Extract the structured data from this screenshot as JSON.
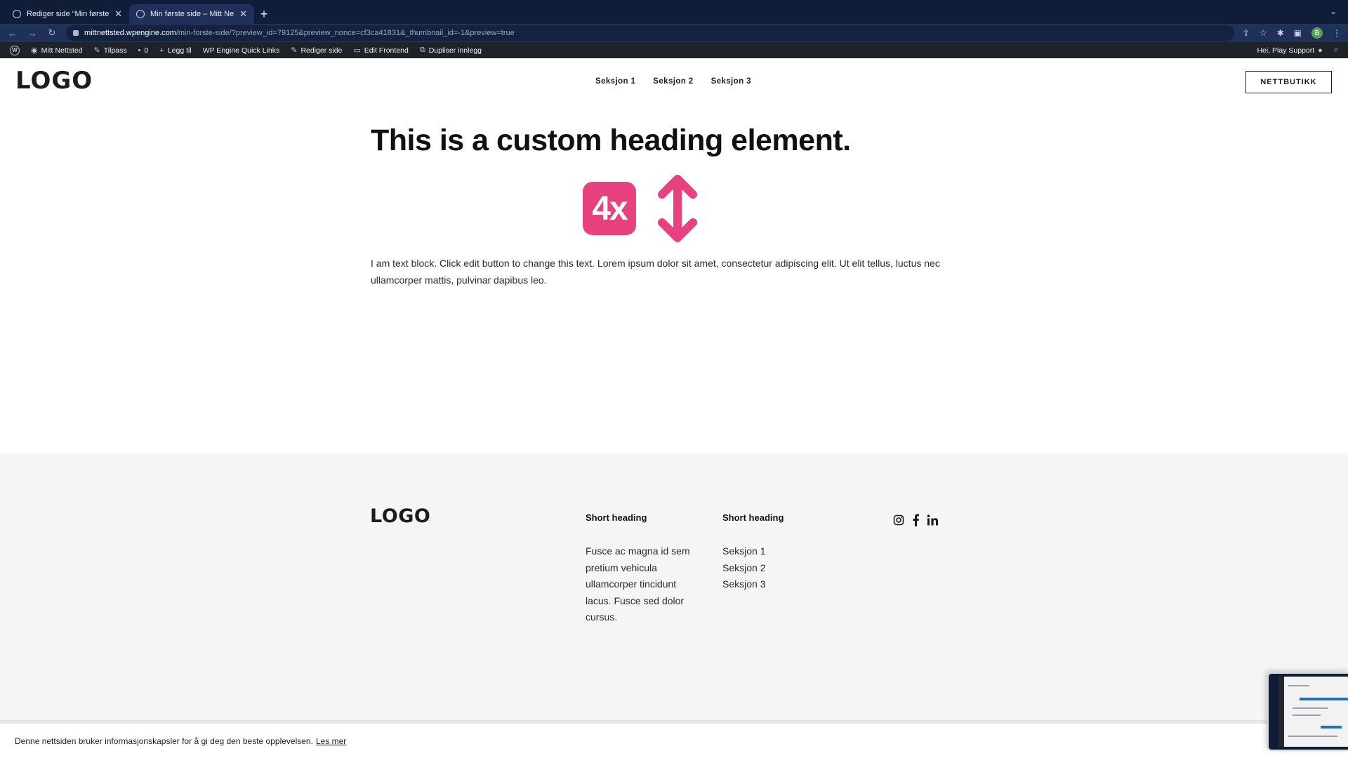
{
  "browser": {
    "tabs": [
      {
        "label": "Rediger side “Min første side”",
        "active": false
      },
      {
        "label": "Min første side – Mitt Nettsted",
        "active": true
      }
    ],
    "url_host": "mittnettsted.wpengine.com",
    "url_path": "/min-forste-side/?preview_id=79125&preview_nonce=cf3ca41831&_thumbnail_id=-1&preview=true",
    "profile_initial": "B"
  },
  "adminbar": {
    "site_name": "Mitt Nettsted",
    "customize": "Tilpass",
    "comments_count": "0",
    "add_new": "Legg til",
    "quick_links": "WP Engine Quick Links",
    "edit_page": "Rediger side",
    "edit_frontend": "Edit Frontend",
    "duplicate": "Dupliser innlegg",
    "greeting": "Hei, Play Support"
  },
  "header": {
    "logo": "LOGO",
    "nav": [
      "Seksjon 1",
      "Seksjon 2",
      "Seksjon 3"
    ],
    "shop_button": "NETTBUTIKK"
  },
  "main": {
    "heading": "This is a custom heading element.",
    "badge_text": "4x",
    "body_text": "I am text block. Click edit button to change this text. Lorem ipsum dolor sit amet, consectetur adipiscing elit. Ut elit tellus, luctus nec ullamcorper mattis, pulvinar dapibus leo."
  },
  "footer": {
    "logo": "LOGO",
    "col1_heading": "Short heading",
    "col1_text": "Fusce ac magna id sem pretium vehicula ullamcorper tincidunt lacus. Fusce sed dolor cursus.",
    "col2_heading": "Short heading",
    "col2_links": [
      "Seksjon 1",
      "Seksjon 2",
      "Seksjon 3"
    ],
    "socials": [
      "instagram-icon",
      "facebook-icon",
      "linkedin-icon"
    ]
  },
  "cookie": {
    "text": "Denne nettsiden bruker informasjonskapsler for å gi deg den beste opplevelsen.",
    "link": "Les mer"
  },
  "colors": {
    "accent_pink": "#e8417f",
    "browser_chrome": "#0f1d39",
    "admin_bar": "#1d2327",
    "footer_bg": "#f5f5f5"
  }
}
